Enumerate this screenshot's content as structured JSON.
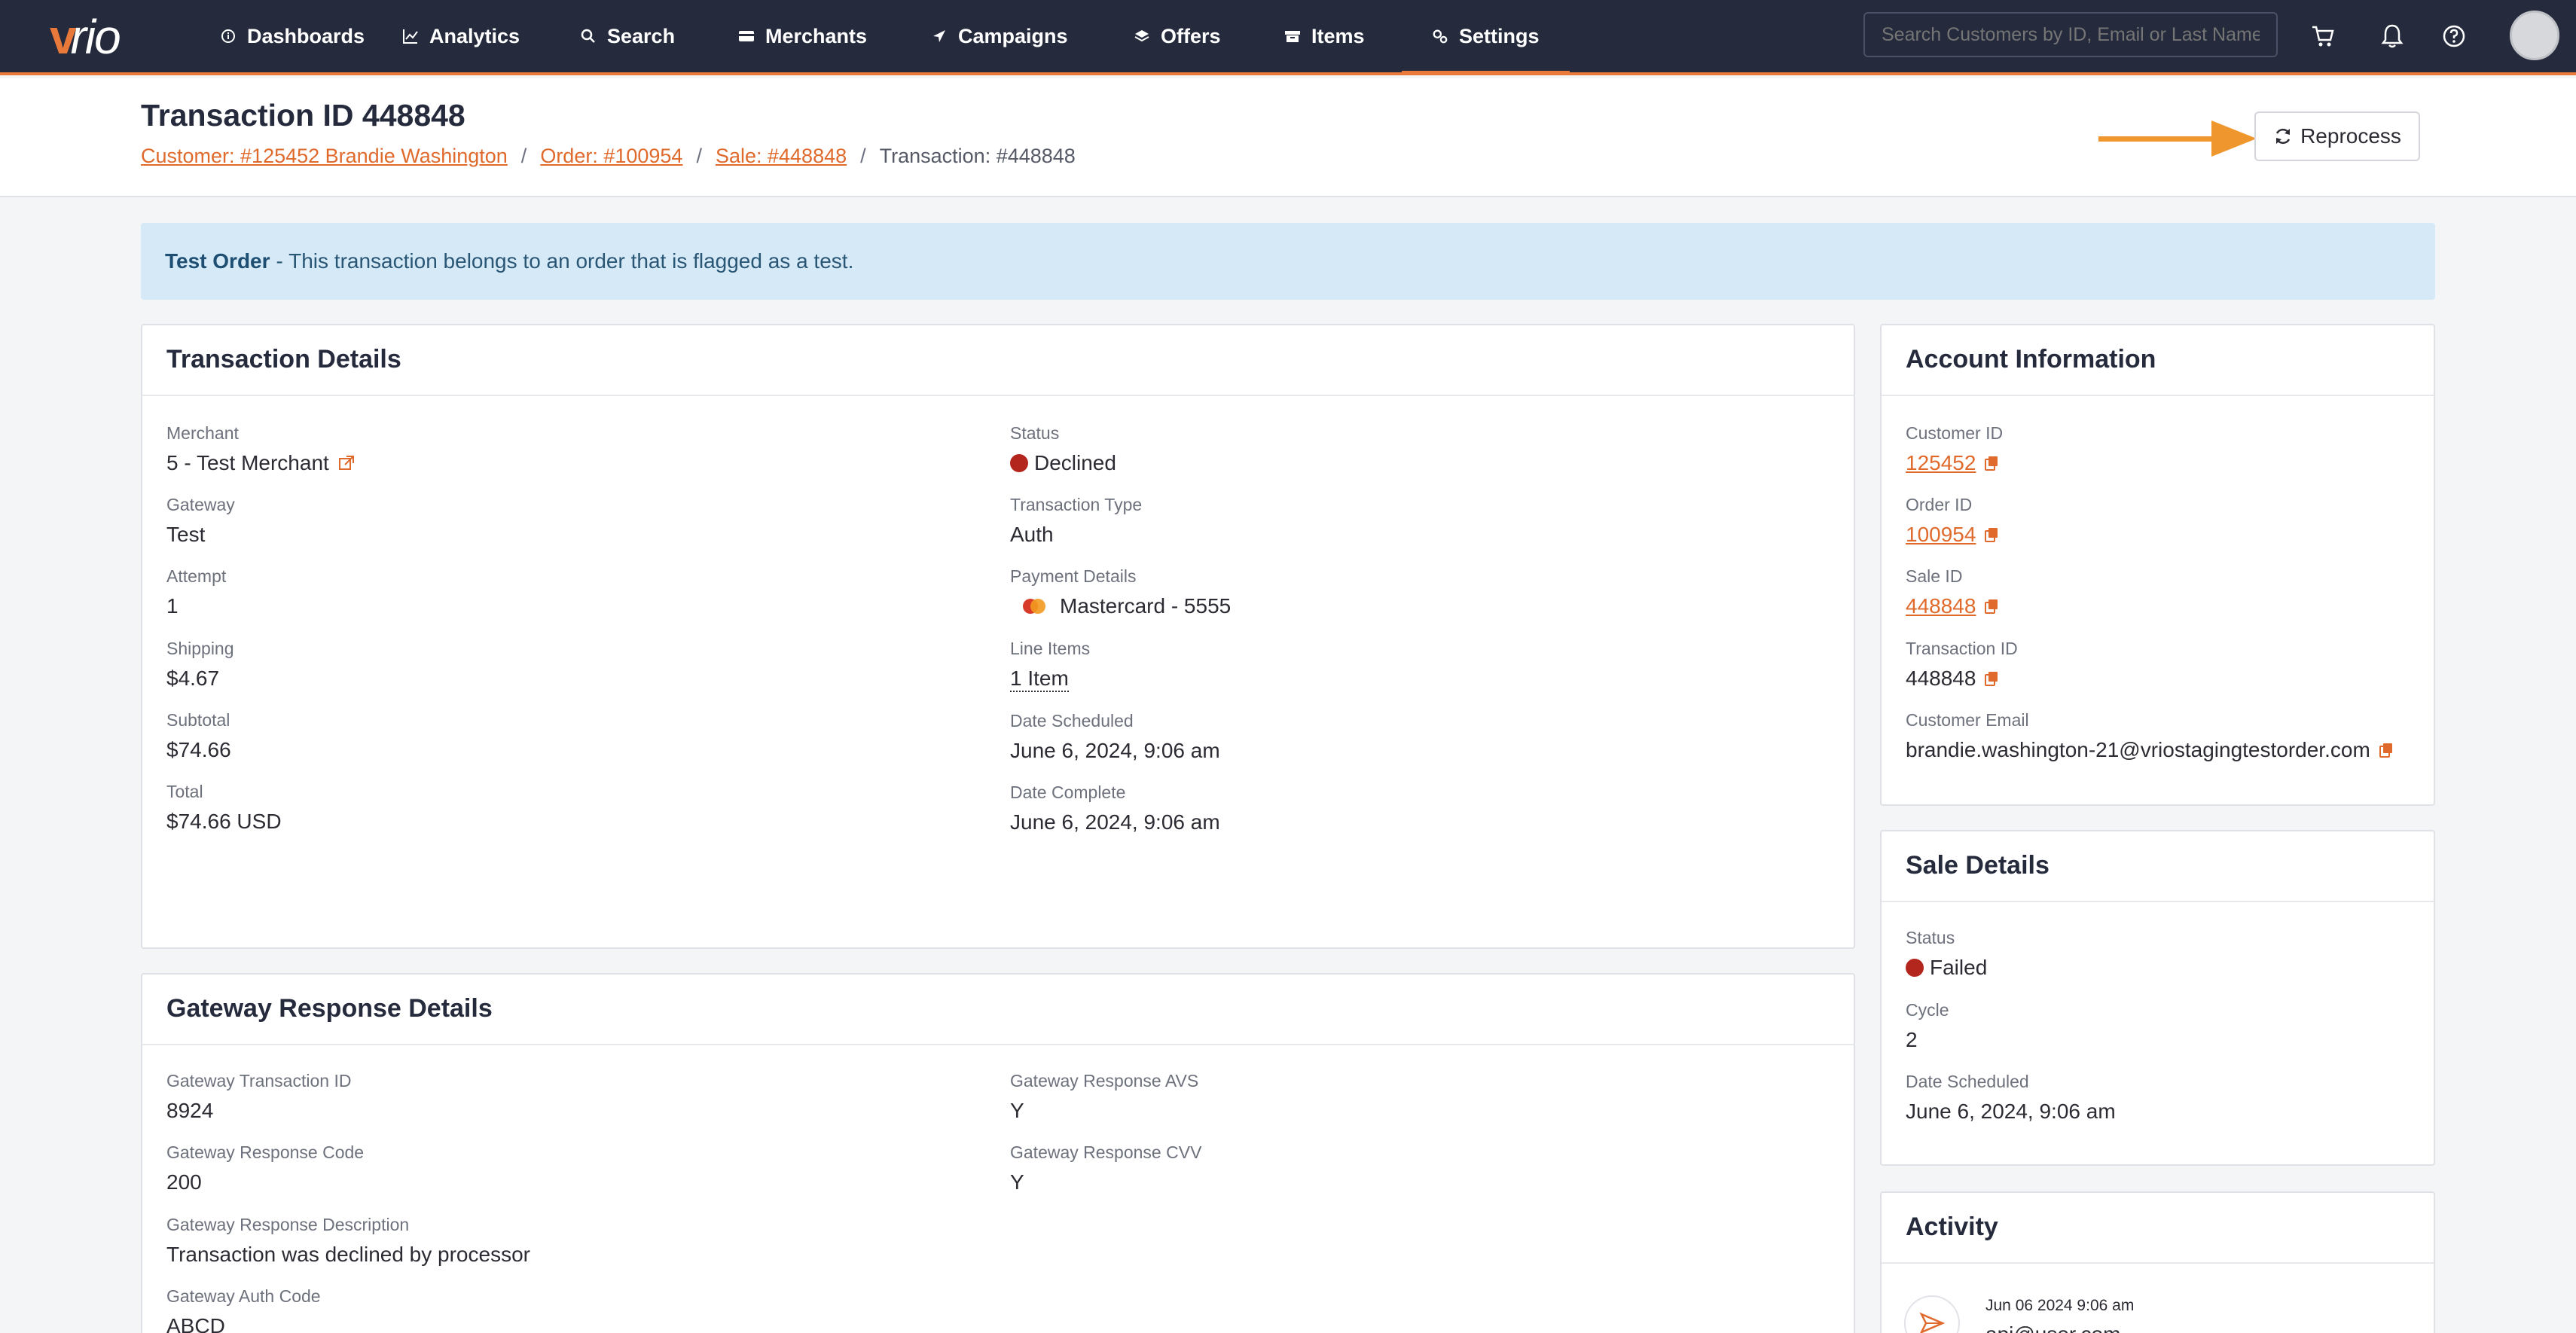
{
  "brand": {
    "logo_text": "vrio",
    "accent": "#e8793a",
    "nav_bg": "#252b3c"
  },
  "nav": {
    "items": [
      {
        "label": "Dashboards",
        "icon": "info-icon"
      },
      {
        "label": "Analytics",
        "icon": "chart-line-icon"
      },
      {
        "label": "Search",
        "icon": "search-icon"
      },
      {
        "label": "Merchants",
        "icon": "credit-card-icon"
      },
      {
        "label": "Campaigns",
        "icon": "paper-plane-icon"
      },
      {
        "label": "Offers",
        "icon": "layers-icon"
      },
      {
        "label": "Items",
        "icon": "box-icon"
      },
      {
        "label": "Settings",
        "icon": "gears-icon"
      }
    ],
    "active": "Settings",
    "search_placeholder": "Search Customers by ID, Email or Last Name"
  },
  "header": {
    "title": "Transaction ID 448848",
    "breadcrumb": {
      "customer": "Customer: #125452 Brandie Washington",
      "order": "Order: #100954",
      "sale": "Sale: #448848",
      "transaction": "Transaction: #448848",
      "separator": "/"
    },
    "reprocess_label": "Reprocess"
  },
  "banner": {
    "strong": "Test Order",
    "text": "- This transaction belongs to an order that is flagged as a test."
  },
  "transaction_details": {
    "title": "Transaction Details",
    "merchant_label": "Merchant",
    "merchant": "5 - Test Merchant",
    "gateway_label": "Gateway",
    "gateway": "Test",
    "attempt_label": "Attempt",
    "attempt": "1",
    "shipping_label": "Shipping",
    "shipping": "$4.67",
    "subtotal_label": "Subtotal",
    "subtotal": "$74.66",
    "total_label": "Total",
    "total": "$74.66 USD",
    "status_label": "Status",
    "status": "Declined",
    "type_label": "Transaction Type",
    "type": "Auth",
    "payment_label": "Payment Details",
    "payment": "Mastercard - 5555",
    "line_items_label": "Line Items",
    "line_items": "1 Item",
    "date_scheduled_label": "Date Scheduled",
    "date_scheduled": "June 6, 2024, 9:06 am",
    "date_complete_label": "Date Complete",
    "date_complete": "June 6, 2024, 9:06 am"
  },
  "gateway_response": {
    "title": "Gateway Response Details",
    "txn_id_label": "Gateway Transaction ID",
    "txn_id": "8924",
    "code_label": "Gateway Response Code",
    "code": "200",
    "desc_label": "Gateway Response Description",
    "desc": "Transaction was declined by processor",
    "auth_label": "Gateway Auth Code",
    "auth": "ABCD",
    "avs_label": "Gateway Response AVS",
    "avs": "Y",
    "cvv_label": "Gateway Response CVV",
    "cvv": "Y"
  },
  "account_info": {
    "title": "Account Information",
    "customer_id_label": "Customer ID",
    "customer_id": "125452",
    "order_id_label": "Order ID",
    "order_id": "100954",
    "sale_id_label": "Sale ID",
    "sale_id": "448848",
    "transaction_id_label": "Transaction ID",
    "transaction_id": "448848",
    "email_label": "Customer Email",
    "email": "brandie.washington-21@vriostagingtestorder.com"
  },
  "sale_details": {
    "title": "Sale Details",
    "status_label": "Status",
    "status": "Failed",
    "cycle_label": "Cycle",
    "cycle": "2",
    "date_label": "Date Scheduled",
    "date": "June 6, 2024, 9:06 am"
  },
  "activity": {
    "title": "Activity",
    "entry_date": "Jun 06 2024 9:06 am",
    "entry_user": "api@user.com"
  },
  "colors": {
    "declined": "#b3261e",
    "link": "#e06a2c",
    "banner_bg": "#d5e9f7"
  }
}
